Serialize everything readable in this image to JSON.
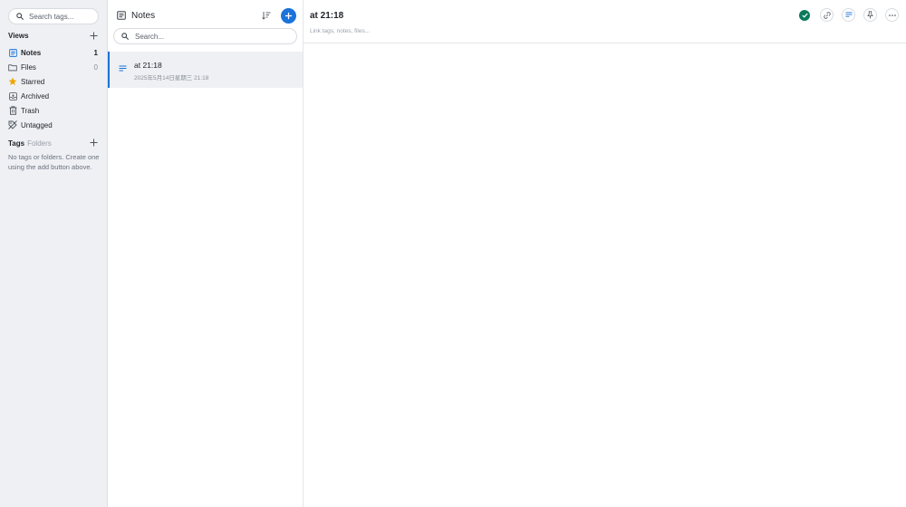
{
  "sidebar": {
    "tag_search_placeholder": "Search tags...",
    "views_title": "Views",
    "views": [
      {
        "label": "Notes",
        "count": "1",
        "icon": "notes-icon"
      },
      {
        "label": "Files",
        "count": "0",
        "icon": "folder-icon"
      },
      {
        "label": "Starred",
        "count": "",
        "icon": "star-icon"
      },
      {
        "label": "Archived",
        "count": "",
        "icon": "archive-icon"
      },
      {
        "label": "Trash",
        "count": "",
        "icon": "trash-icon"
      },
      {
        "label": "Untagged",
        "count": "",
        "icon": "untagged-icon"
      }
    ],
    "tags_title": "Tags",
    "tags_subtitle": "Folders",
    "tags_empty": "No tags or folders. Create one using the add button above."
  },
  "list": {
    "title": "Notes",
    "search_placeholder": "Search...",
    "notes": [
      {
        "title": "at 21:18",
        "date": "2025年5月14日星期三 21:18"
      }
    ]
  },
  "editor": {
    "title": "at 21:18",
    "link_placeholder": "Link tags, notes, files..."
  },
  "colors": {
    "accent": "#1a73d9",
    "saved": "#0a7a5c",
    "star": "#f0a500"
  }
}
